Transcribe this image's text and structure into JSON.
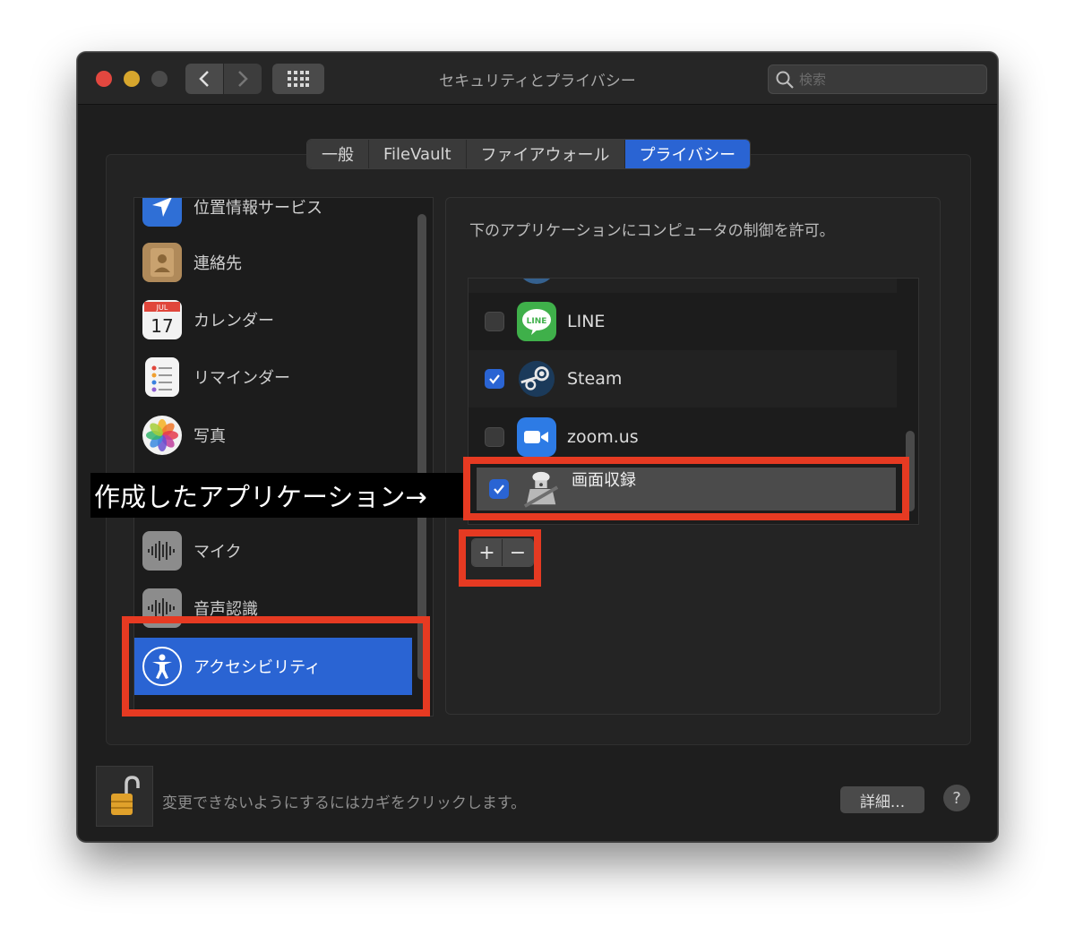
{
  "window": {
    "title": "セキュリティとプライバシー",
    "search_placeholder": "検索"
  },
  "tabs": [
    {
      "label": "一般",
      "active": false
    },
    {
      "label": "FileVault",
      "active": false
    },
    {
      "label": "ファイアウォール",
      "active": false
    },
    {
      "label": "プライバシー",
      "active": true
    }
  ],
  "sidebar": {
    "items": [
      {
        "label": "位置情報サービス",
        "icon": "location-arrow-icon"
      },
      {
        "label": "連絡先",
        "icon": "contacts-book-icon"
      },
      {
        "label": "カレンダー",
        "icon": "calendar-icon",
        "icon_month": "JUL",
        "icon_day": "17"
      },
      {
        "label": "リマインダー",
        "icon": "reminders-list-icon"
      },
      {
        "label": "写真",
        "icon": "photos-flower-icon"
      },
      {
        "label": "マイク",
        "icon": "microphone-waveform-icon"
      },
      {
        "label": "音声認識",
        "icon": "speech-recognition-waveform-icon"
      },
      {
        "label": "アクセシビリティ",
        "icon": "accessibility-person-icon",
        "selected": true
      }
    ]
  },
  "panel": {
    "description": "下のアプリケーションにコンピュータの制御を許可。",
    "apps": [
      {
        "name": "LINE",
        "checked": false,
        "icon": "line-app-icon",
        "icon_text": "LINE"
      },
      {
        "name": "Steam",
        "checked": true,
        "icon": "steam-app-icon"
      },
      {
        "name": "zoom.us",
        "checked": false,
        "icon": "zoom-camera-icon"
      },
      {
        "name": "画面収録",
        "checked": true,
        "icon": "automator-robot-icon"
      }
    ],
    "add_label": "+",
    "remove_label": "−"
  },
  "footer": {
    "lock_text": "変更できないようにするにはカギをクリックします。",
    "details_label": "詳細...",
    "help_label": "?"
  },
  "annotation": {
    "text": "作成したアプリケーション→"
  },
  "colors": {
    "accent": "#2a64d3",
    "annotation_red": "#e63a22"
  }
}
